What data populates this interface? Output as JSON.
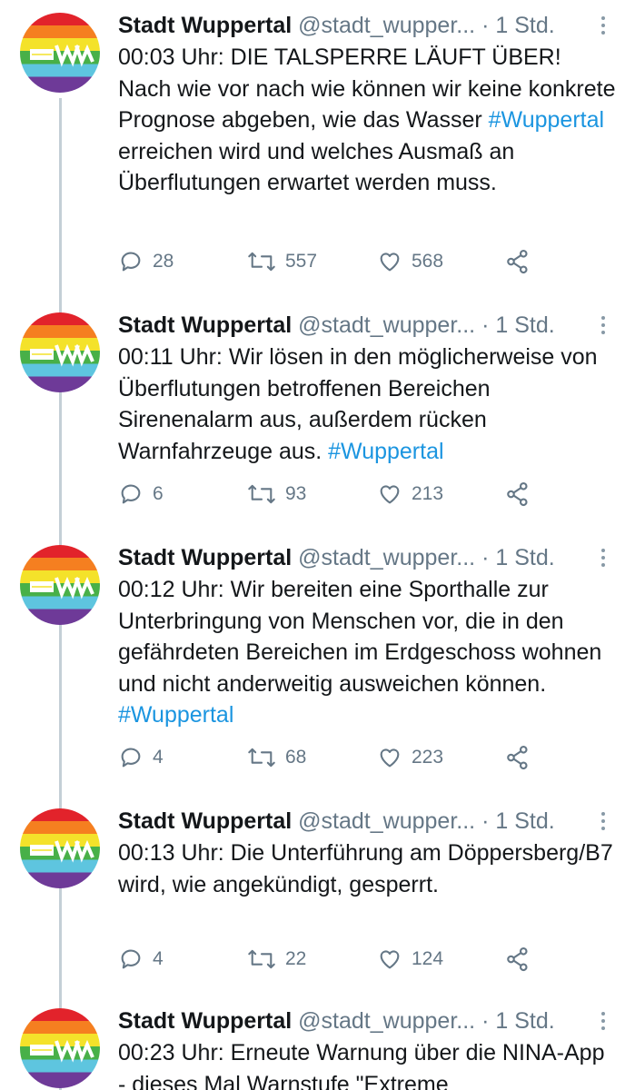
{
  "tweets": [
    {
      "name": "Stadt Wuppertal",
      "handle": "@stadt_wupper...",
      "sep": "·",
      "time": "1 Std.",
      "text_before": "00:03 Uhr: DIE TALSPERRE LÄUFT ÜBER! Nach wie vor nach wie können wir keine konkrete Prognose abgeben, wie das Wasser ",
      "hashtag": "#Wuppertal",
      "text_after": " erreichen wird und welches Ausmaß an Überflutungen erwartet werden muss.",
      "replies": "28",
      "retweets": "557",
      "likes": "568"
    },
    {
      "name": "Stadt Wuppertal",
      "handle": "@stadt_wupper...",
      "sep": "·",
      "time": "1 Std.",
      "text_before": "00:11 Uhr: Wir lösen in den möglicherweise von Überflutungen betroffenen Bereichen Sirenenalarm aus, außerdem rücken Warnfahrzeuge aus. ",
      "hashtag": "#Wuppertal",
      "text_after": "",
      "replies": "6",
      "retweets": "93",
      "likes": "213"
    },
    {
      "name": "Stadt Wuppertal",
      "handle": "@stadt_wupper...",
      "sep": "·",
      "time": "1 Std.",
      "text_before": "00:12 Uhr: Wir bereiten eine Sporthalle zur Unterbringung von Menschen vor, die in den gefährdeten Bereichen im Erdgeschoss wohnen und nicht anderweitig ausweichen können. ",
      "hashtag": "#Wuppertal",
      "text_after": "",
      "replies": "4",
      "retweets": "68",
      "likes": "223"
    },
    {
      "name": "Stadt Wuppertal",
      "handle": "@stadt_wupper...",
      "sep": "·",
      "time": "1 Std.",
      "text_before": "00:13 Uhr: Die Unterführung am Döppersberg/B7 wird, wie angekündigt, gesperrt.",
      "hashtag": "",
      "text_after": "",
      "replies": "4",
      "retweets": "22",
      "likes": "124"
    },
    {
      "name": "Stadt Wuppertal",
      "handle": "@stadt_wupper...",
      "sep": "·",
      "time": "1 Std.",
      "text_before": "00:23 Uhr: Erneute Warnung über die NINA-App - dieses Mal Warnstufe \"Extreme",
      "hashtag": "",
      "text_after": "",
      "replies": "",
      "retweets": "",
      "likes": ""
    }
  ],
  "icons": {
    "reply": "reply-icon",
    "retweet": "retweet-icon",
    "like": "heart-icon",
    "share": "share-icon",
    "more": "more-vertical-icon",
    "avatar": "stadt-wuppertal-rainbow-logo"
  },
  "colors": {
    "hashtag": "#1b95e0",
    "secondary_text": "#657786",
    "thread_line": "#c4cfd6"
  }
}
